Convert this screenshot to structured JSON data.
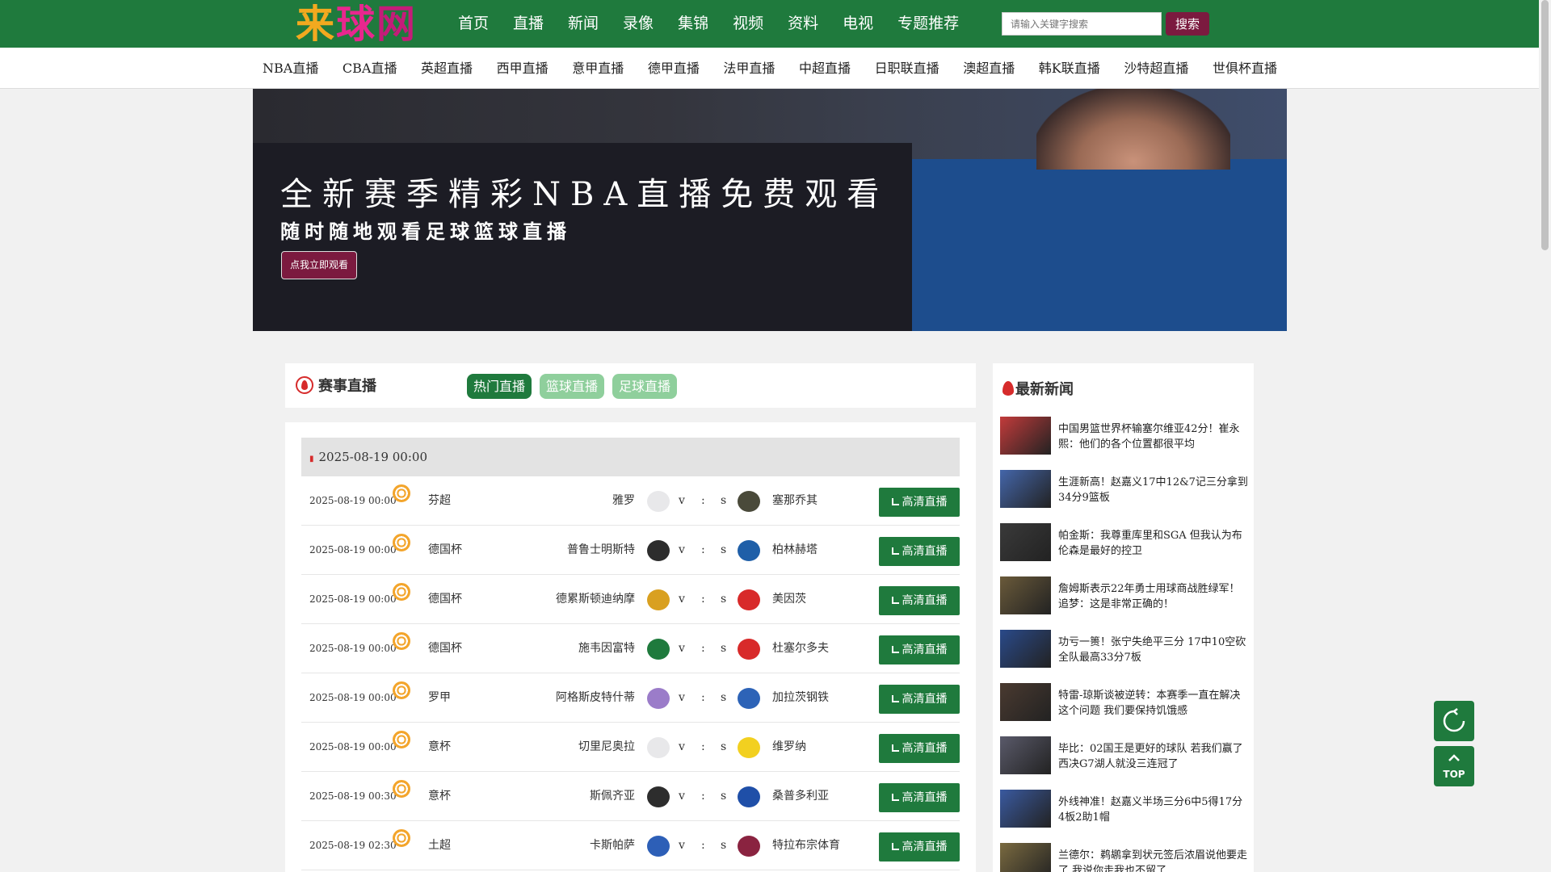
{
  "header": {
    "logo": [
      "来",
      "球",
      "网"
    ],
    "nav": [
      "首页",
      "直播",
      "新闻",
      "录像",
      "集锦",
      "视频",
      "资料",
      "电视",
      "专题推荐"
    ],
    "search_placeholder": "请输入关键字搜索",
    "search_label": "搜索"
  },
  "subnav": [
    "NBA直播",
    "CBA直播",
    "英超直播",
    "西甲直播",
    "意甲直播",
    "德甲直播",
    "法甲直播",
    "中超直播",
    "日职联直播",
    "澳超直播",
    "韩K联直播",
    "沙特超直播",
    "世俱杯直播"
  ],
  "banner": {
    "headline": "全新赛季精彩NBA直播免费观看",
    "subline": "随时随地观看足球篮球直播",
    "cta": "点我立即观看"
  },
  "schedule": {
    "title": "赛事直播",
    "tabs": [
      "热门直播",
      "篮球直播",
      "足球直播"
    ],
    "date": "2025-08-19 00:00",
    "live_label": "高清直播",
    "v": "v",
    "colon": ":",
    "s": "s",
    "rows": [
      {
        "time": "2025-08-19 00:00",
        "league": "芬超",
        "home": "雅罗",
        "away": "塞那乔其",
        "home_color": "#e8e8ea",
        "away_color": "#4a4a3a"
      },
      {
        "time": "2025-08-19 00:00",
        "league": "德国杯",
        "home": "普鲁士明斯特",
        "away": "柏林赫塔",
        "home_color": "#2d2d2d",
        "away_color": "#1f5fa8"
      },
      {
        "time": "2025-08-19 00:00",
        "league": "德国杯",
        "home": "德累斯顿迪纳摩",
        "away": "美因茨",
        "home_color": "#d9a020",
        "away_color": "#d82a2a"
      },
      {
        "time": "2025-08-19 00:00",
        "league": "德国杯",
        "home": "施韦因富特",
        "away": "杜塞尔多夫",
        "home_color": "#1f7a3d",
        "away_color": "#d82a2a"
      },
      {
        "time": "2025-08-19 00:00",
        "league": "罗甲",
        "home": "阿格斯皮特什蒂",
        "away": "加拉茨钢铁",
        "home_color": "#9b7cc9",
        "away_color": "#2d63b7"
      },
      {
        "time": "2025-08-19 00:00",
        "league": "意杯",
        "home": "切里尼奥拉",
        "away": "维罗纳",
        "home_color": "#e8e8ea",
        "away_color": "#f2d020"
      },
      {
        "time": "2025-08-19 00:30",
        "league": "意杯",
        "home": "斯佩齐亚",
        "away": "桑普多利亚",
        "home_color": "#2d2d2d",
        "away_color": "#1f4fa8"
      },
      {
        "time": "2025-08-19 02:30",
        "league": "土超",
        "home": "卡斯帕萨",
        "away": "特拉布宗体育",
        "home_color": "#2d5fb7",
        "away_color": "#8a2340"
      }
    ]
  },
  "news": {
    "title": "最新新闻",
    "items": [
      {
        "text": "中国男篮世界杯输塞尔维亚42分！崔永熙：他们的各个位置都很平均",
        "color": "#c23b3b"
      },
      {
        "text": "生涯新高！赵嘉义17中12&7记三分拿到34分9篮板",
        "color": "#4466aa"
      },
      {
        "text": "帕金斯：我尊重库里和SGA 但我认为布伦森是最好的控卫",
        "color": "#3a3a3a"
      },
      {
        "text": "詹姆斯表示22年勇士用球商战胜绿军！追梦：这是非常正确的！",
        "color": "#6a5a3a"
      },
      {
        "text": "功亏一篑！张宁失绝平三分 17中10空砍全队最高33分7板",
        "color": "#2a4a8a"
      },
      {
        "text": "特雷-琼斯谈被逆转：本赛季一直在解决这个问题 我们要保持饥饿感",
        "color": "#4a3a30"
      },
      {
        "text": "毕比：02国王是更好的球队 若我们赢了西决G7湖人就没三连冠了",
        "color": "#5a5a6a"
      },
      {
        "text": "外线神准！赵嘉义半场三分6中5得17分4板2助1帽",
        "color": "#3a5aa0"
      },
      {
        "text": "兰德尔：鹈鹕拿到状元签后浓眉说他要走了 我说你走我也不留了",
        "color": "#7a6a40"
      }
    ]
  },
  "float": {
    "refresh_icon": "refresh-icon",
    "top_label": "TOP"
  }
}
